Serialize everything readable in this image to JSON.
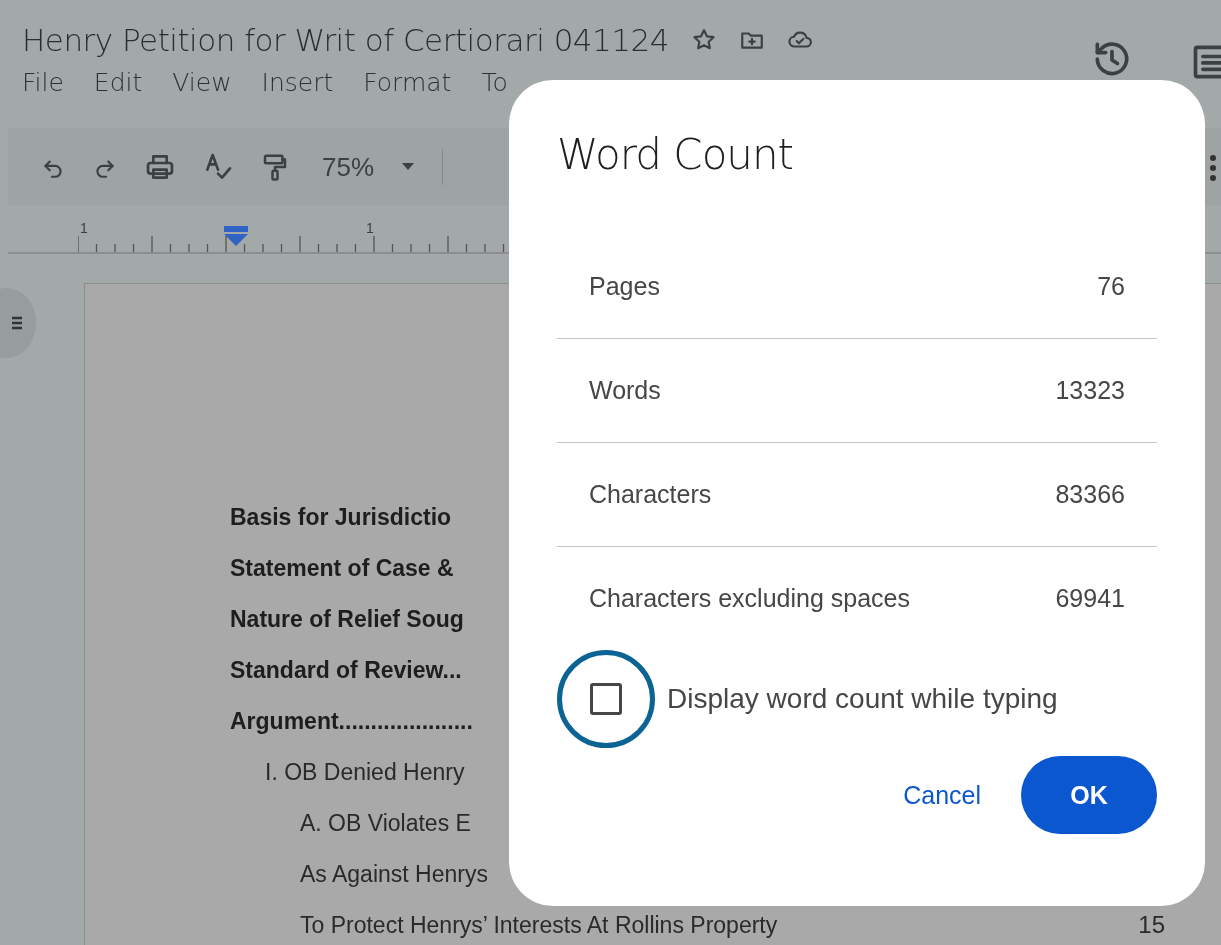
{
  "document_title": "Henry Petition for Writ of Certiorari 041124",
  "menu": [
    "File",
    "Edit",
    "View",
    "Insert",
    "Format",
    "To"
  ],
  "toolbar": {
    "zoom": "75%"
  },
  "ruler": [
    "1",
    "1"
  ],
  "document_lines": [
    {
      "text": "Basis for Jurisdictio",
      "kind": "heading"
    },
    {
      "text": "Statement of Case &",
      "kind": "heading"
    },
    {
      "text": "Nature of Relief Soug",
      "kind": "heading"
    },
    {
      "text": "Standard of Review...",
      "kind": "heading"
    },
    {
      "text": "Argument.....................",
      "kind": "heading"
    },
    {
      "text": "I. OB Denied Henry",
      "kind": "section"
    },
    {
      "text": "A. OB Violates E",
      "kind": "subsection"
    },
    {
      "text": "As Against Henrys",
      "kind": "subsection"
    },
    {
      "text": "To Protect Henrys’ Interests At Rollins Property",
      "kind": "subsection",
      "page": "15"
    }
  ],
  "dialog": {
    "title": "Word Count",
    "stats": [
      {
        "label": "Pages",
        "value": "76"
      },
      {
        "label": "Words",
        "value": "13323"
      },
      {
        "label": "Characters",
        "value": "83366"
      },
      {
        "label": "Characters excluding spaces",
        "value": "69941"
      }
    ],
    "checkbox": {
      "label": "Display word count while typing",
      "checked": false,
      "focused": true
    },
    "buttons": [
      {
        "label": "Cancel",
        "kind": "text"
      },
      {
        "label": "OK",
        "kind": "primary"
      }
    ]
  }
}
